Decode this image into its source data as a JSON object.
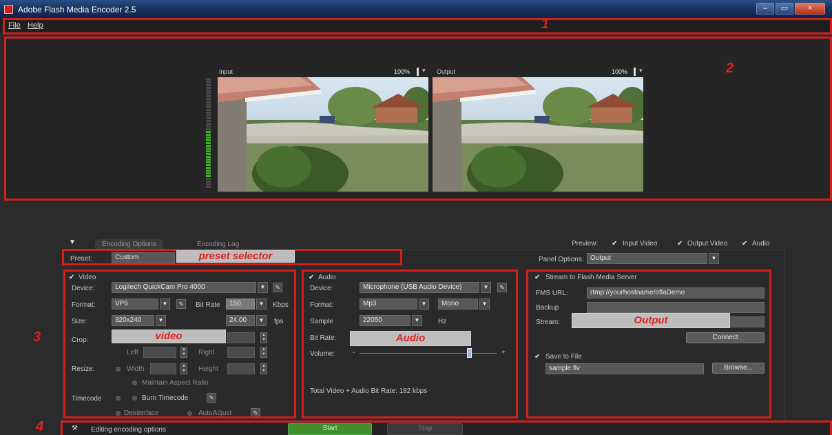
{
  "window": {
    "title": "Adobe Flash Media Encoder 2.5",
    "controls": [
      "–",
      "▭",
      "×"
    ]
  },
  "menu": [
    "File",
    "Help"
  ],
  "annotations": {
    "num1": "1",
    "num2": "2",
    "num3": "3",
    "num4": "4",
    "preset_selector": "preset selector",
    "video": "video",
    "audio": "Audio",
    "output": "Output"
  },
  "preview": {
    "input_label": "Input",
    "output_label": "Output",
    "input_zoom": "100%",
    "output_zoom": "100%"
  },
  "tabs": {
    "active": "Encoding Options",
    "inactive": "Encoding Log"
  },
  "preview_options": {
    "label": "Preview:",
    "input_video": "Input Video",
    "output_video": "Output Video",
    "audio": "Audio"
  },
  "preset": {
    "label": "Preset:",
    "value": "Custom"
  },
  "panel_options": {
    "label": "Panel Options:",
    "value": "Output"
  },
  "video": {
    "header": "Video",
    "device_label": "Device:",
    "device": "Logitech QuickCam Pro 4000",
    "format_label": "Format:",
    "format": "VP6",
    "bitrate_label": "Bit Rate",
    "bitrate": "150",
    "bitrate_unit": "Kbps",
    "size_label": "Size:",
    "size": "320x240",
    "fps": "24.00",
    "fps_unit": "fps",
    "crop_label": "Crop:",
    "left_label": "Left",
    "right_label": "Right",
    "resize_label": "Resize:",
    "width_label": "Width",
    "height_label": "Height",
    "maintain_aspect": "Maintain Aspect Ratio",
    "timecode_label": "Timecode",
    "burn_timecode": "Burn Timecode",
    "deinterlace": "Deinterlace",
    "autoadjust": "AutoAdjust"
  },
  "audio": {
    "header": "Audio",
    "device_label": "Device:",
    "device": "Microphone (USB Audio Device)",
    "format_label": "Format:",
    "format": "Mp3",
    "channels": "Mono",
    "sample_label": "Sample",
    "sample": "22050",
    "sample_unit": "Hz",
    "bitrate_label": "Bit Rate:",
    "volume_label": "Volume:",
    "volume_minus": "-",
    "volume_plus": "+",
    "volume_level": 0.8,
    "total": "Total Video + Audio Bit Rate: 182 kbps"
  },
  "output": {
    "stream_check": "Stream to Flash Media Server",
    "fms_url_label": "FMS URL:",
    "fms_url": "rtmp://yourhostname/oflaDemo",
    "backup_label": "Backup",
    "stream_label": "Stream:",
    "connect": "Connect",
    "save_check": "Save to File",
    "file": "sample.flv",
    "browse": "Browse..."
  },
  "status": {
    "text": "Editing encoding options",
    "start": "Start",
    "stop": "Stop"
  },
  "colors": {
    "annotation_red": "#d61e1e",
    "start_green": "#3f8f2f"
  }
}
